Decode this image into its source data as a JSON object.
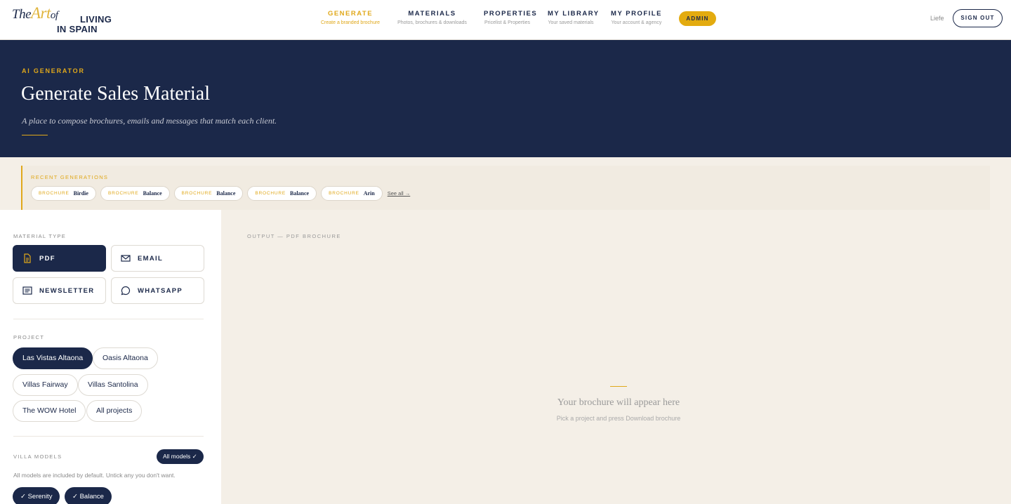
{
  "brand": {
    "line1_the": "The",
    "line1_art": "Art",
    "line1_of": "of",
    "line2": "LIVING",
    "line3": "IN SPAIN"
  },
  "nav": [
    {
      "title": "GENERATE",
      "subtitle": "Create a branded brochure",
      "active": true
    },
    {
      "title": "MATERIALS",
      "subtitle": "Photos, brochures & downloads"
    },
    {
      "title": "PROPERTIES",
      "subtitle": "Pricelist & Properties"
    },
    {
      "title": "MY LIBRARY",
      "subtitle": "Your saved materials"
    },
    {
      "title": "MY PROFILE",
      "subtitle": "Your account & agency"
    }
  ],
  "admin_label": "ADMIN",
  "user_name": "Liefe",
  "signout_label": "SIGN OUT",
  "hero": {
    "kicker": "AI GENERATOR",
    "title": "Generate Sales Material",
    "subtitle": "A place to compose brochures, emails and messages that match each client."
  },
  "recent": {
    "label": "RECENT GENERATIONS",
    "items": [
      {
        "kind": "BROCHURE",
        "name": "Birdie"
      },
      {
        "kind": "BROCHURE",
        "name": "Balance"
      },
      {
        "kind": "BROCHURE",
        "name": "Balance"
      },
      {
        "kind": "BROCHURE",
        "name": "Balance"
      },
      {
        "kind": "BROCHURE",
        "name": "Arin"
      }
    ],
    "see_all": "See all →"
  },
  "material_type": {
    "label": "MATERIAL TYPE",
    "options": [
      {
        "label": "PDF",
        "icon": "pdf-file-icon",
        "selected": true
      },
      {
        "label": "EMAIL",
        "icon": "mail-icon"
      },
      {
        "label": "NEWSLETTER",
        "icon": "newsletter-icon"
      },
      {
        "label": "WHATSAPP",
        "icon": "chat-bubble-icon"
      }
    ]
  },
  "project": {
    "label": "PROJECT",
    "options": [
      "Las Vistas Altaona",
      "Oasis Altaona",
      "Villas Fairway",
      "Villas Santolina",
      "The WOW Hotel",
      "All projects"
    ],
    "selected": "Las Vistas Altaona"
  },
  "villa_models": {
    "label": "VILLA MODELS",
    "all_button": "All models ✓",
    "helper": "All models are included by default. Untick any you don't want.",
    "models": [
      "✓ Serenity",
      "✓ Balance"
    ]
  },
  "output": {
    "label": "OUTPUT — PDF BROCHURE",
    "placeholder_title": "Your brochure will appear here",
    "placeholder_sub": "Pick a project and press Download brochure"
  },
  "colors": {
    "navy": "#1b2849",
    "gold": "#e0a81a",
    "cream": "#f4efe7"
  }
}
